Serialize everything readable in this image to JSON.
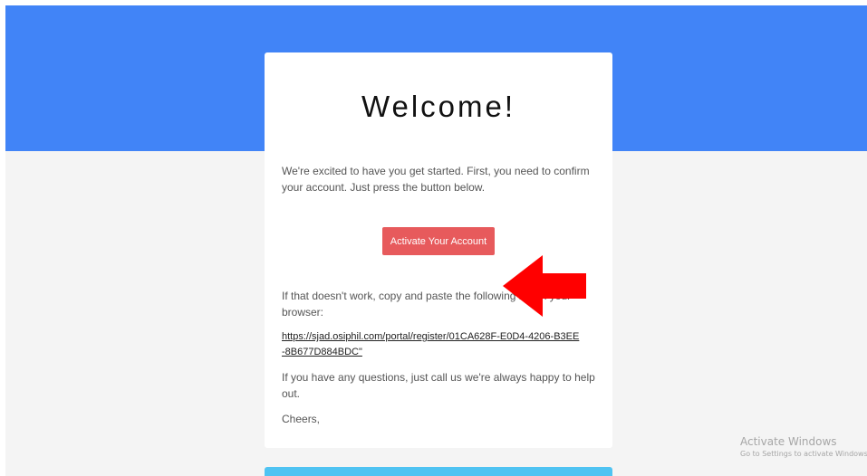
{
  "email": {
    "title": "Welcome!",
    "intro": "We're excited to have you get started. First, you need to confirm your account. Just press the button below.",
    "button_label": "Activate Your Account",
    "fallback": "If that doesn't work, copy and paste the following link in your browser:",
    "link": "https://sjad.osiphil.com/portal/register/01CA628F-E0D4-4206-B3EE-8B677D884BDC\"",
    "questions": "If you have any questions, just call us we're always happy to help out.",
    "signoff": "Cheers,"
  },
  "watermark": {
    "title": "Activate Windows",
    "subtitle": "Go to Settings to activate Windows."
  },
  "colors": {
    "header_blue": "#4184f7",
    "button_red": "#e75a5c",
    "arrow_red": "#ff0000",
    "footer_cyan": "#4fc3f2",
    "page_bg": "#f4f4f4"
  },
  "icons": {
    "annotation": "red-arrow-left-icon"
  }
}
